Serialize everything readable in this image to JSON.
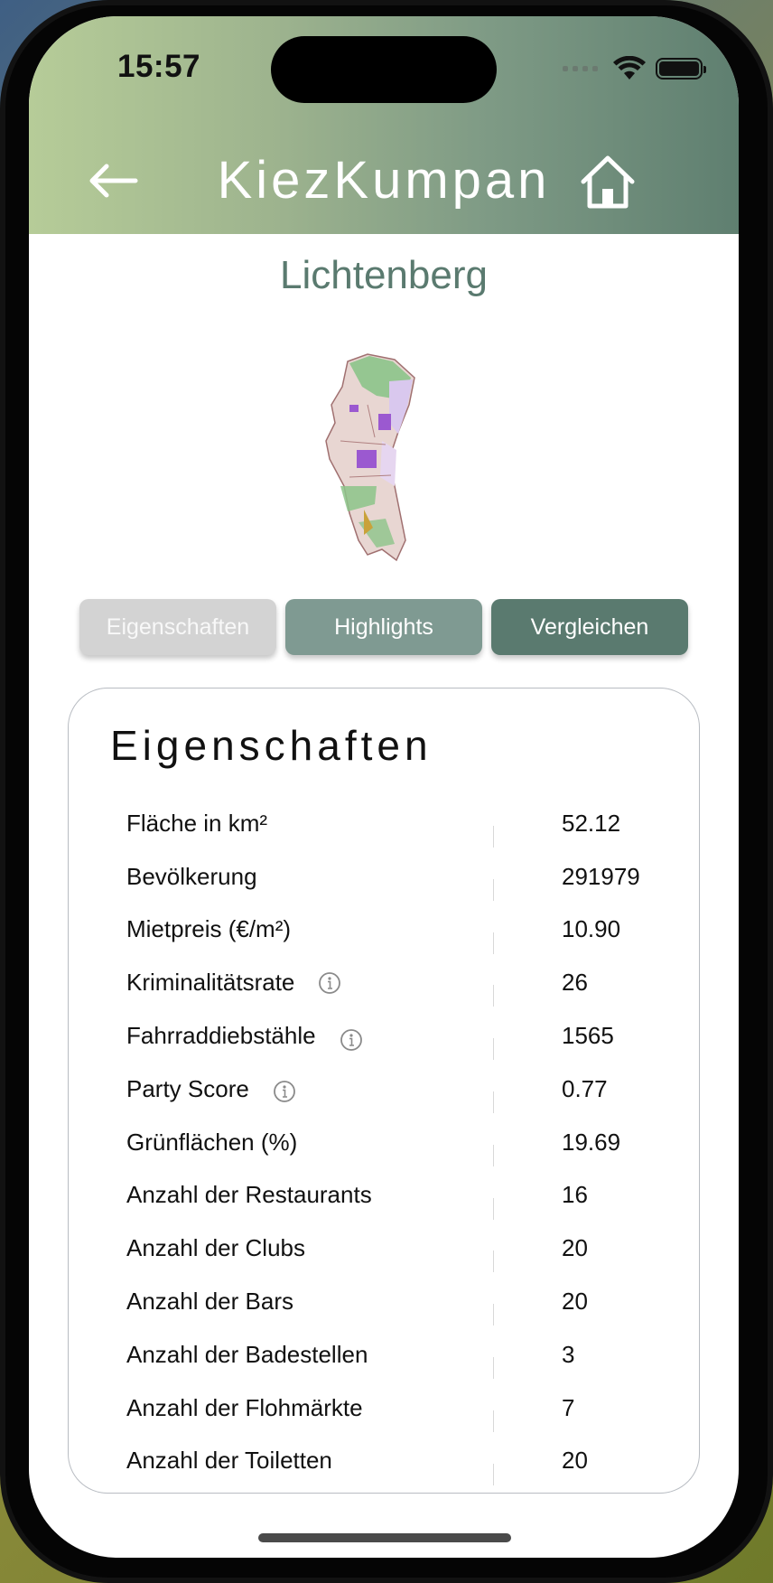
{
  "status_bar": {
    "time": "15:57"
  },
  "header": {
    "title": "KiezKumpan",
    "back_icon": "arrow-left-icon",
    "home_icon": "home-icon",
    "gradient_start": "#b6cc98",
    "gradient_end": "#5f7f70"
  },
  "district": {
    "name": "Lichtenberg"
  },
  "tabs": [
    {
      "label": "Eigenschaften",
      "color": "#d3d3d3",
      "selected": false
    },
    {
      "label": "Highlights",
      "color": "#7f9a92",
      "selected": false
    },
    {
      "label": "Vergleichen",
      "color": "#5a7a6f",
      "selected": false
    }
  ],
  "properties": {
    "title": "Eigenschaften",
    "rows": [
      {
        "label": "Fläche in km²",
        "value": "52.12",
        "info": false
      },
      {
        "label": "Bevölkerung",
        "value": "291979",
        "info": false
      },
      {
        "label": "Mietpreis (€/m²)",
        "value": "10.90",
        "info": false
      },
      {
        "label": "Kriminalitätsrate",
        "value": "26",
        "info": true
      },
      {
        "label": "Fahrraddiebstähle",
        "value": "1565",
        "info": true
      },
      {
        "label": "Party Score",
        "value": "0.77",
        "info": true
      },
      {
        "label": "Grünflächen (%)",
        "value": "19.69",
        "info": false
      },
      {
        "label": "Anzahl der Restaurants",
        "value": "16",
        "info": false
      },
      {
        "label": "Anzahl der Clubs",
        "value": "20",
        "info": false
      },
      {
        "label": "Anzahl der Bars",
        "value": "20",
        "info": false
      },
      {
        "label": "Anzahl der Badestellen",
        "value": "3",
        "info": false
      },
      {
        "label": "Anzahl der Flohmärkte",
        "value": "7",
        "info": false
      },
      {
        "label": "Anzahl der Toiletten",
        "value": "20",
        "info": false
      }
    ]
  }
}
